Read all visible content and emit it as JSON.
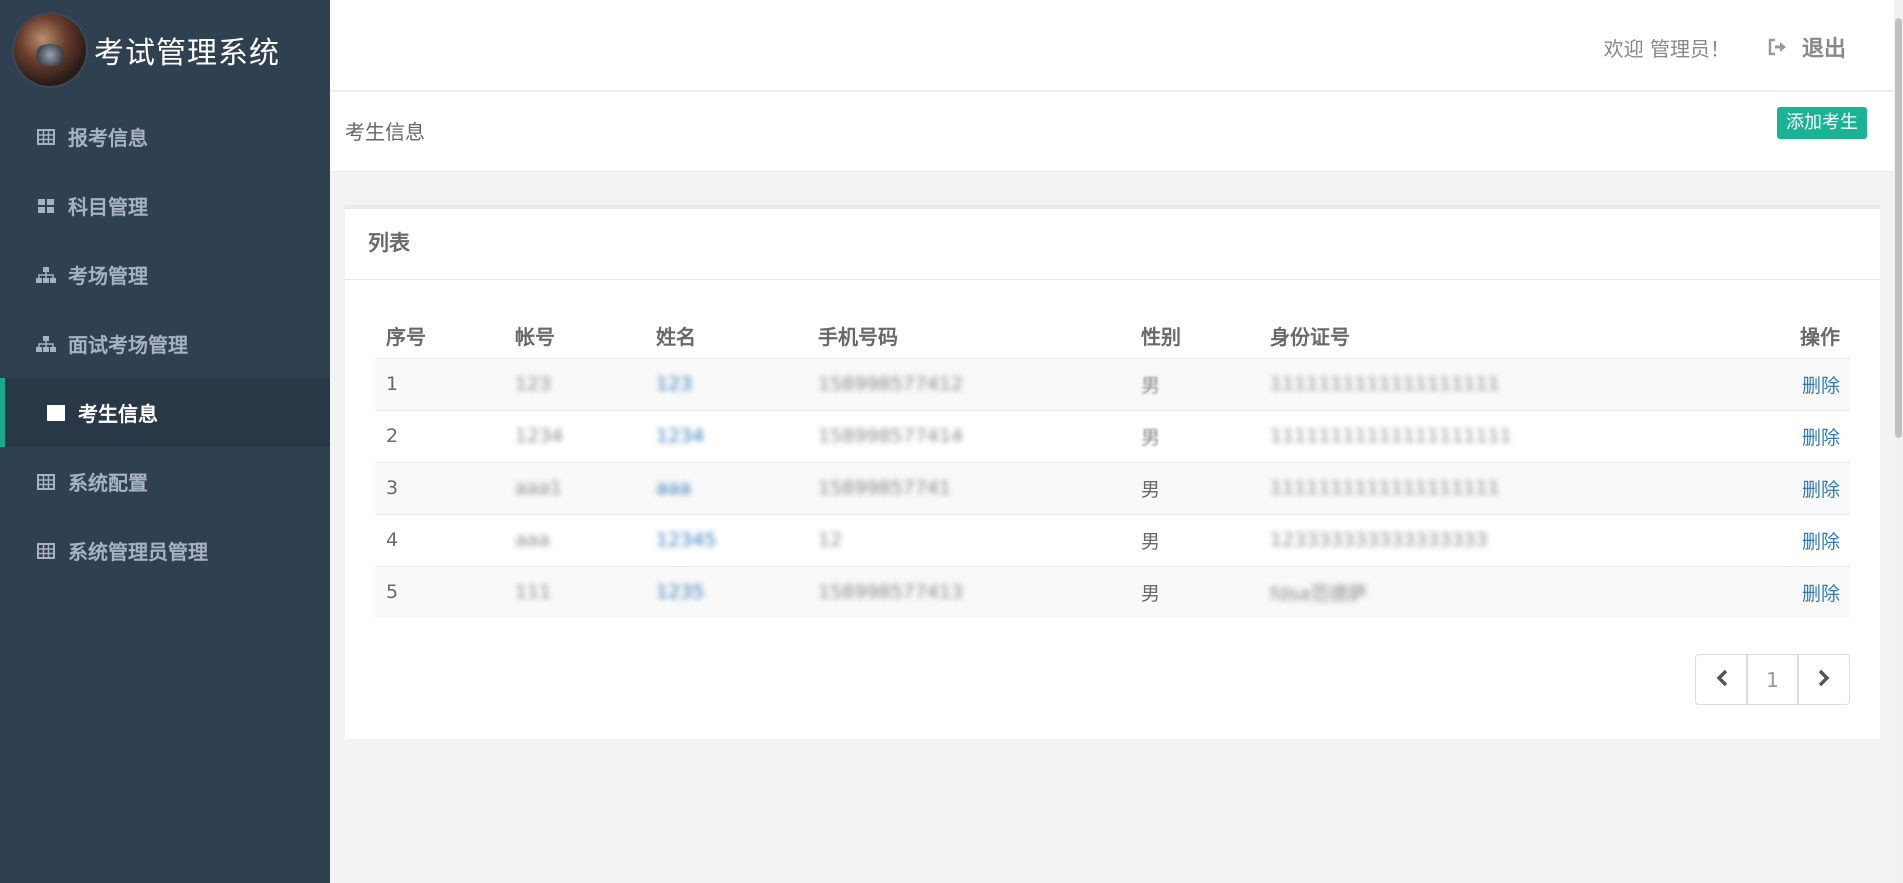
{
  "app": {
    "title": "考试管理系统"
  },
  "sidebar": {
    "items": [
      {
        "label": "报考信息",
        "icon": "table-icon",
        "active": false
      },
      {
        "label": "科目管理",
        "icon": "grid-icon",
        "active": false
      },
      {
        "label": "考场管理",
        "icon": "sitemap-icon",
        "active": false
      },
      {
        "label": "面试考场管理",
        "icon": "sitemap-icon",
        "active": false
      },
      {
        "label": "考生信息",
        "icon": "table-icon",
        "active": true
      },
      {
        "label": "系统配置",
        "icon": "table-icon",
        "active": false
      },
      {
        "label": "系统管理员管理",
        "icon": "table-icon",
        "active": false
      }
    ]
  },
  "header": {
    "welcome": "欢迎 管理员！",
    "logout_label": "退出"
  },
  "breadcrumb": {
    "title": "考生信息",
    "add_button": "添加考生"
  },
  "panel": {
    "title": "列表",
    "columns": [
      "序号",
      "帐号",
      "姓名",
      "手机号码",
      "性别",
      "身份证号",
      "操作"
    ],
    "rows": [
      {
        "index": "1",
        "account": "123",
        "name": "123",
        "phone": "15899857741​2",
        "gender": "男",
        "id_number": "1111111111111111111",
        "action": "删除"
      },
      {
        "index": "2",
        "account": "1234",
        "name": "1234",
        "phone": "15899857741​4",
        "gender": "男",
        "id_number": "11111111111111111111",
        "action": "删除"
      },
      {
        "index": "3",
        "account": "aaa1",
        "name": "aaa",
        "phone": "1589985774​1",
        "gender": "男",
        "id_number": "1111111111111111111",
        "action": "删除"
      },
      {
        "index": "4",
        "account": "aaa",
        "name": "12345",
        "phone": "12",
        "gender": "男",
        "id_number": "123333333333333333",
        "action": "删除"
      },
      {
        "index": "5",
        "account": "111",
        "name": "1235",
        "phone": "15899857741​3",
        "gender": "男",
        "id_number": "fdsa范德萨",
        "action": "删除"
      }
    ]
  },
  "pagination": {
    "current": "1"
  },
  "colors": {
    "sidebar_bg": "#2f4050",
    "sidebar_active_bg": "#293846",
    "accent": "#1ab394",
    "link": "#337ab7"
  }
}
